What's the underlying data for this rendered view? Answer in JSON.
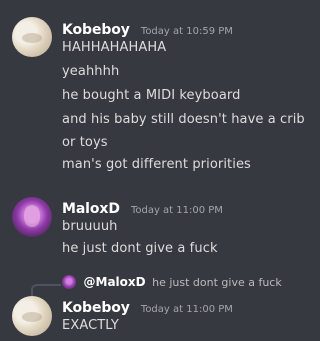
{
  "messages": [
    {
      "author": "Kobeboy",
      "timestamp": "Today at 10:59 PM",
      "lines": [
        "HAHHAHAHAHA",
        "yeahhhh",
        "he bought a MIDI keyboard",
        "and his baby still doesn't have a crib",
        "or toys",
        "man's got different priorities"
      ]
    },
    {
      "author": "MaloxD",
      "timestamp": "Today at 11:00 PM",
      "lines": [
        "bruuuuh",
        "he just dont give a fuck"
      ]
    },
    {
      "author": "Kobeboy",
      "timestamp": "Today at 11:00 PM",
      "reply": {
        "mention": "@MaloxD",
        "text": "he just dont give a fuck"
      },
      "lines": [
        "EXACTLY"
      ]
    }
  ]
}
